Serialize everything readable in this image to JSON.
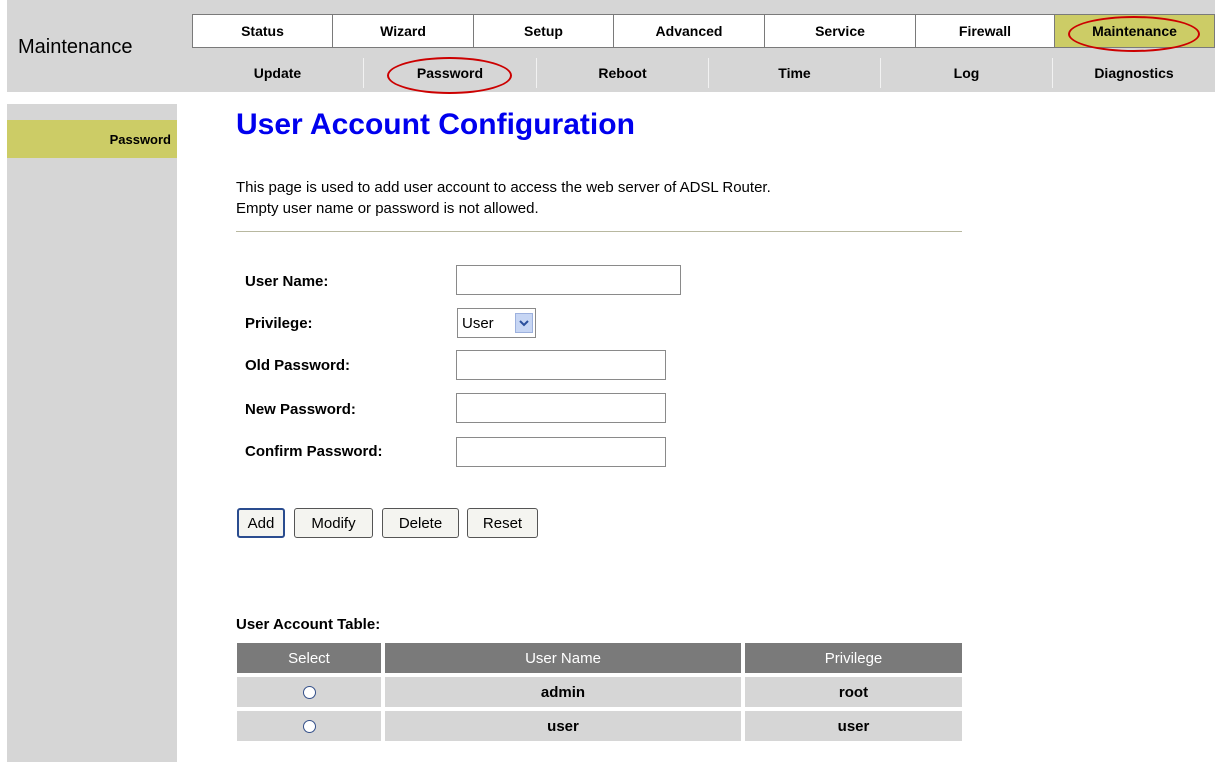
{
  "section_title": "Maintenance",
  "top_nav": [
    "Status",
    "Wizard",
    "Setup",
    "Advanced",
    "Service",
    "Firewall",
    "Maintenance"
  ],
  "sub_nav": [
    "Update",
    "Password",
    "Reboot",
    "Time",
    "Log",
    "Diagnostics"
  ],
  "sidebar": {
    "items": [
      "Password"
    ]
  },
  "page_title": "User Account Configuration",
  "description": {
    "line1": "This page is used to add user account to access the web server of ADSL Router.",
    "line2": "Empty user name or password is not allowed."
  },
  "form": {
    "user_name_label": "User Name:",
    "user_name_value": "",
    "privilege_label": "Privilege:",
    "privilege_value": "User",
    "old_password_label": "Old Password:",
    "new_password_label": "New Password:",
    "confirm_password_label": "Confirm Password:"
  },
  "buttons": {
    "add": "Add",
    "modify": "Modify",
    "delete": "Delete",
    "reset": "Reset"
  },
  "table": {
    "title": "User Account Table:",
    "headers": [
      "Select",
      "User Name",
      "Privilege"
    ],
    "rows": [
      {
        "user_name": "admin",
        "privilege": "root"
      },
      {
        "user_name": "user",
        "privilege": "user"
      }
    ]
  },
  "colors": {
    "active_tab": "#cccc66",
    "header_band": "#d6d6d6",
    "page_title": "#0000ee",
    "annotation_circle": "#cc0000"
  }
}
